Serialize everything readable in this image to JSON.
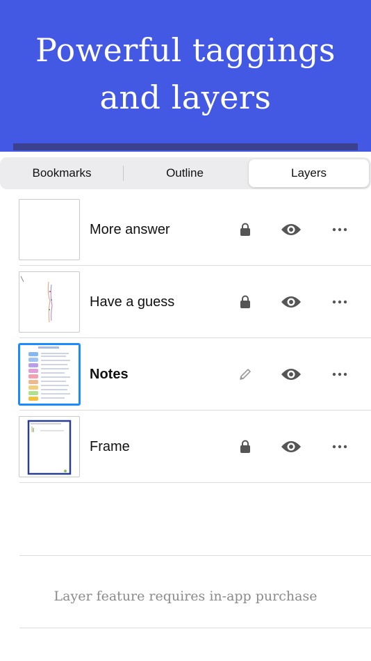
{
  "banner": {
    "title_line1": "Powerful taggings",
    "title_line2": "and layers",
    "background_color": "#4359e3"
  },
  "tabs": [
    {
      "label": "Bookmarks",
      "selected": false
    },
    {
      "label": "Outline",
      "selected": false
    },
    {
      "label": "Layers",
      "selected": true
    }
  ],
  "layers": [
    {
      "name": "More answer",
      "status_icon": "lock-icon",
      "visible": true,
      "selected": false,
      "thumbnail": "blank"
    },
    {
      "name": "Have a guess",
      "status_icon": "lock-icon",
      "visible": true,
      "selected": false,
      "thumbnail": "sketch"
    },
    {
      "name": "Notes",
      "status_icon": "pencil-icon",
      "visible": true,
      "selected": true,
      "thumbnail": "notes"
    },
    {
      "name": "Frame",
      "status_icon": "lock-icon",
      "visible": true,
      "selected": false,
      "thumbnail": "frame"
    }
  ],
  "footer": {
    "purchase_note": "Layer feature requires in-app purchase"
  },
  "colors": {
    "accent": "#1a8cff",
    "icon": "#555555"
  }
}
